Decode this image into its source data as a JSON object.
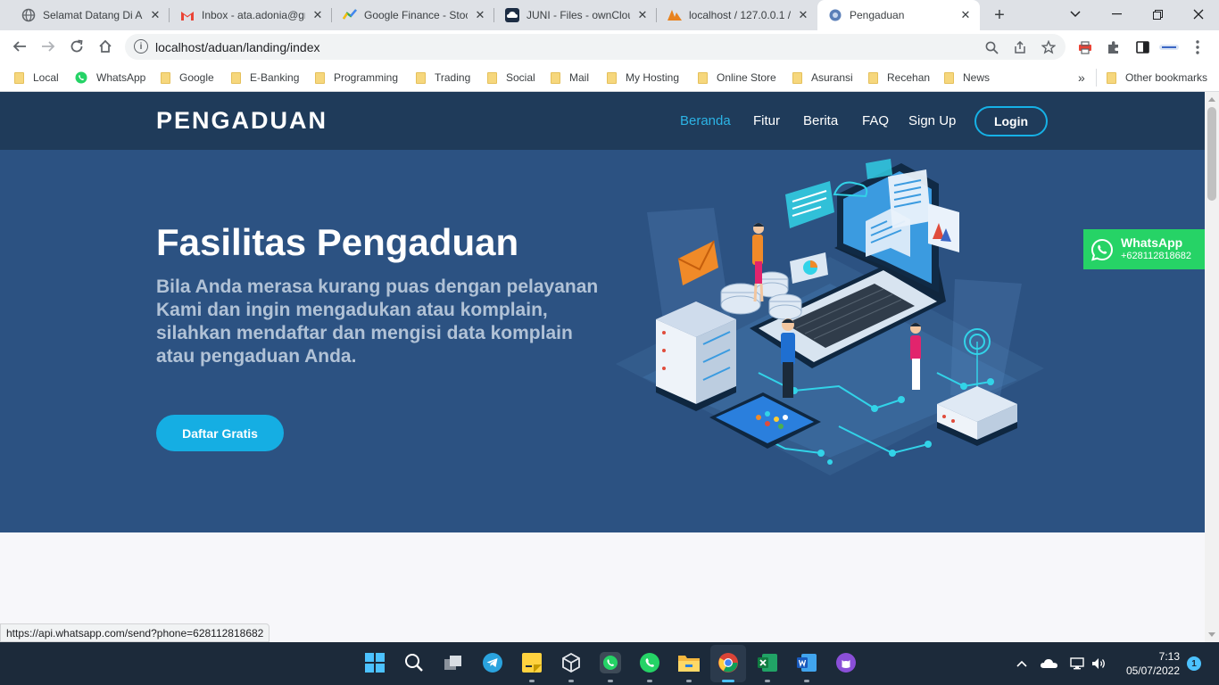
{
  "browser": {
    "tabs": [
      {
        "label": "Selamat Datang Di Ap",
        "icon": "globe-icon",
        "active": false
      },
      {
        "label": "Inbox - ata.adonia@gr",
        "icon": "gmail-icon",
        "active": false
      },
      {
        "label": "Google Finance - Stoc",
        "icon": "google-finance-icon",
        "active": false
      },
      {
        "label": "JUNI - Files - ownClou",
        "icon": "owncloud-icon",
        "active": false
      },
      {
        "label": "localhost / 127.0.0.1 /",
        "icon": "phpmyadmin-icon",
        "active": false
      },
      {
        "label": "Pengaduan",
        "icon": "site-icon",
        "active": true
      }
    ],
    "address": "localhost/aduan/landing/index",
    "bookmarks": [
      {
        "label": "Local",
        "icon": "folder-icon"
      },
      {
        "label": "WhatsApp",
        "icon": "whatsapp-icon"
      },
      {
        "label": "Google",
        "icon": "folder-icon"
      },
      {
        "label": "E-Banking",
        "icon": "folder-icon"
      },
      {
        "label": "Programming",
        "icon": "folder-icon"
      },
      {
        "label": "Trading",
        "icon": "folder-icon"
      },
      {
        "label": "Social",
        "icon": "folder-icon"
      },
      {
        "label": "Mail",
        "icon": "folder-icon"
      },
      {
        "label": "My Hosting",
        "icon": "folder-icon"
      },
      {
        "label": "Online Store",
        "icon": "folder-icon"
      },
      {
        "label": "Asuransi",
        "icon": "folder-icon"
      },
      {
        "label": "Recehan",
        "icon": "folder-icon"
      },
      {
        "label": "News",
        "icon": "folder-icon"
      }
    ],
    "overflow": "»",
    "other_bookmarks": "Other bookmarks",
    "status_url": "https://api.whatsapp.com/send?phone=628112818682"
  },
  "site": {
    "brand": "PENGADUAN",
    "nav": [
      "Beranda",
      "Fitur",
      "Berita",
      "FAQ",
      "Sign Up"
    ],
    "login": "Login",
    "hero": {
      "title": "Fasilitas Pengaduan",
      "subtitle": "Bila Anda merasa kurang puas dengan pelayanan Kami dan ingin mengadukan atau komplain, silahkan mendaftar dan mengisi data komplain atau pengaduan Anda.",
      "cta": "Daftar Gratis"
    },
    "whatsapp_widget": {
      "name": "WhatsApp",
      "phone": "+628112818682"
    }
  },
  "taskbar": {
    "time": "7:13",
    "date": "05/07/2022",
    "notifications": "1"
  },
  "colors": {
    "nav_bg": "#1f3b5a",
    "hero_bg": "#2c5282",
    "accent": "#15aee3",
    "whatsapp": "#26d366"
  }
}
